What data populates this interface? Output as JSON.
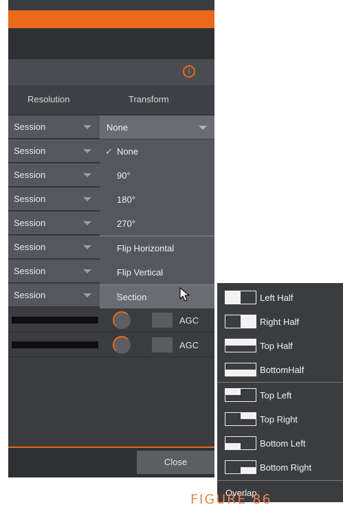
{
  "header": {
    "resolution_label": "Resolution",
    "transform_label": "Transform"
  },
  "rows": [
    {
      "resolution": "Session"
    },
    {
      "resolution": "Session"
    },
    {
      "resolution": "Session"
    },
    {
      "resolution": "Session"
    },
    {
      "resolution": "Session"
    },
    {
      "resolution": "Session"
    },
    {
      "resolution": "Session"
    },
    {
      "resolution": "Session"
    }
  ],
  "transform_select": {
    "value": "None"
  },
  "transform_menu": {
    "items": [
      {
        "label": "None",
        "checked": true
      },
      {
        "label": "90°"
      },
      {
        "label": "180°"
      },
      {
        "label": "270°"
      },
      {
        "label": "Flip Horizontal"
      },
      {
        "label": "Flip Vertical"
      },
      {
        "label": "Section",
        "submenu": true
      }
    ],
    "check_glyph": "✓"
  },
  "section_menu": {
    "items": [
      {
        "label": "Left Half",
        "icon": "left-half-icon"
      },
      {
        "label": "Right Half",
        "icon": "right-half-icon"
      },
      {
        "label": "Top Half",
        "icon": "top-half-icon"
      },
      {
        "label": "BottomHalf",
        "icon": "bottom-half-icon"
      },
      {
        "label": "Top Left",
        "icon": "top-left-icon"
      },
      {
        "label": "Top Right",
        "icon": "top-right-icon"
      },
      {
        "label": "Bottom Left",
        "icon": "bottom-left-icon"
      },
      {
        "label": "Bottom Right",
        "icon": "bottom-right-icon"
      }
    ],
    "overlap_label": "Overlap"
  },
  "audio": {
    "agc_label": "AGC"
  },
  "footer": {
    "close_label": "Close"
  },
  "info_icon": "i",
  "caption": "FIGURE 86",
  "colors": {
    "accent": "#e96a1a",
    "panel": "#3a3c40",
    "row": "#55575c"
  }
}
